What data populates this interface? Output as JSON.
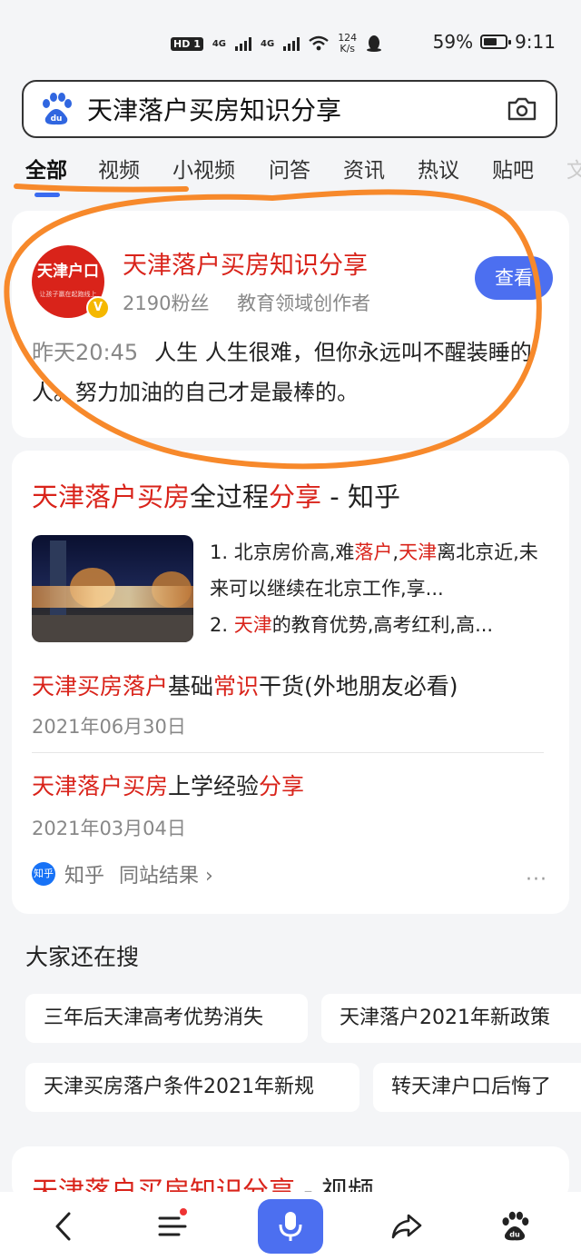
{
  "status_bar": {
    "hd": "HD",
    "sim1": "1",
    "net1": "4G",
    "net2": "4G",
    "speed_value": "124",
    "speed_unit": "K/s",
    "battery": "59%",
    "time": "9:11"
  },
  "search": {
    "query": "天津落户买房知识分享"
  },
  "tabs": [
    "全部",
    "视频",
    "小视频",
    "问答",
    "资讯",
    "热议",
    "贴吧",
    "文"
  ],
  "account_card": {
    "avatar_text": "天津户口",
    "avatar_subtext": "让孩子赢在起跑线上",
    "verified_mark": "V",
    "name": "天津落户买房知识分享",
    "fans": "2190粉丝",
    "domain": "教育领域创作者",
    "view_button": "查看",
    "post_time": "昨天20:45",
    "post_text": "人生 人生很难，但你永远叫不醒装睡的人。努力加油的自己才是最棒的。"
  },
  "zhihu_result": {
    "title_hl1": "天津落户买房",
    "title_mid": "全过程",
    "title_hl2": "分享",
    "title_tail": " - 知乎",
    "snippet1_a": "1. 北京房价高,难",
    "snippet1_b": "落户",
    "snippet1_c": ",",
    "snippet1_d": "天津",
    "snippet1_e": "离北京近,未来可以继续在北京工作,享...",
    "snippet2_a": "2. ",
    "snippet2_b": "天津",
    "snippet2_c": "的教育优势,高考红利,高...",
    "sub1_hl1": "天津买房落户",
    "sub1_mid": "基础",
    "sub1_hl2": "常识",
    "sub1_tail": "干货(外地朋友必看)",
    "sub1_date": "2021年06月30日",
    "sub2_hl1": "天津落户买房",
    "sub2_mid": "上学经验",
    "sub2_hl2": "分享",
    "sub2_date": "2021年03月04日",
    "source_icon": "知乎",
    "source_name": "知乎",
    "source_more": "同站结果 ›",
    "more_dots": "···"
  },
  "also_search": {
    "title": "大家还在搜",
    "chips": [
      "三年后天津高考优势消失",
      "天津落户2021年新政策",
      "天津买房落户条件2021年新规",
      "转天津户口后悔了"
    ]
  },
  "video_result": {
    "title_hl": "天津落户买房知识分享",
    "title_tail": " - 视频"
  },
  "colors": {
    "highlight": "#d9231a",
    "accent": "#4c6ff0",
    "annotation": "#f7892b"
  },
  "icons": [
    "back-icon",
    "menu-icon",
    "mic-icon",
    "share-icon",
    "baidu-paw-icon",
    "camera-icon"
  ]
}
